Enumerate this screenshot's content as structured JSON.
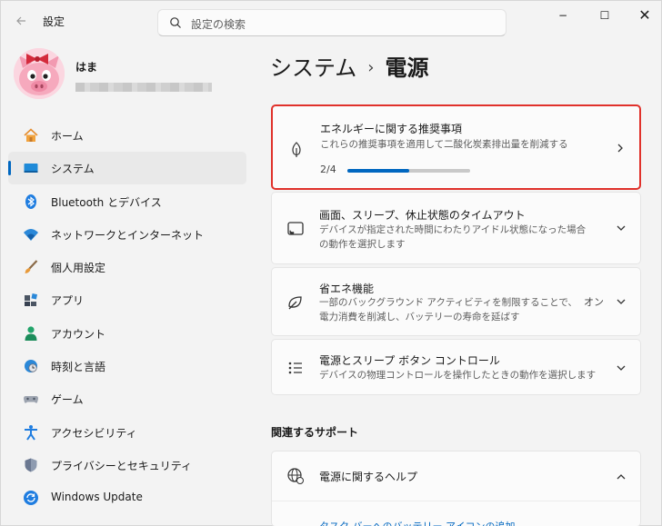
{
  "window": {
    "app_title": "設定",
    "search_placeholder": "設定の検索",
    "minimize": "−",
    "maximize": "☐",
    "close": "✕"
  },
  "profile": {
    "name": "はま"
  },
  "sidebar": {
    "items": [
      {
        "label": "ホーム",
        "icon": "home-icon"
      },
      {
        "label": "システム",
        "icon": "system-icon",
        "active": true
      },
      {
        "label": "Bluetooth とデバイス",
        "icon": "bluetooth-icon"
      },
      {
        "label": "ネットワークとインターネット",
        "icon": "wifi-icon"
      },
      {
        "label": "個人用設定",
        "icon": "brush-icon"
      },
      {
        "label": "アプリ",
        "icon": "apps-icon"
      },
      {
        "label": "アカウント",
        "icon": "account-icon"
      },
      {
        "label": "時刻と言語",
        "icon": "time-language-icon"
      },
      {
        "label": "ゲーム",
        "icon": "gamepad-icon"
      },
      {
        "label": "アクセシビリティ",
        "icon": "accessibility-icon"
      },
      {
        "label": "プライバシーとセキュリティ",
        "icon": "shield-icon"
      },
      {
        "label": "Windows Update",
        "icon": "windows-update-icon"
      }
    ]
  },
  "breadcrumb": {
    "parent": "システム",
    "separator": "›",
    "current": "電源"
  },
  "cards": {
    "recommendations": {
      "title": "エネルギーに関する推奨事項",
      "desc": "これらの推奨事項を適用して二酸化炭素排出量を削減する",
      "progress_label": "2/4",
      "progress": 0.5
    },
    "screen_sleep": {
      "title": "画面、スリープ、休止状態のタイムアウト",
      "desc": "デバイスが指定された時間にわたりアイドル状態になった場合の動作を選択します"
    },
    "energy_saver": {
      "title": "省エネ機能",
      "desc": "一部のバックグラウンド アクティビティを制限することで、電力消費を削減し、バッテリーの寿命を延ばす",
      "status": "オン"
    },
    "power_button": {
      "title": "電源とスリープ ボタン コントロール",
      "desc": "デバイスの物理コントロールを操作したときの動作を選択します"
    }
  },
  "support": {
    "heading": "関連するサポート",
    "help_title": "電源に関するヘルプ",
    "link": "タスク バーへのバッテリー アイコンの追加"
  },
  "colors": {
    "accent": "#0067c0",
    "highlight_border": "#e0312b"
  }
}
